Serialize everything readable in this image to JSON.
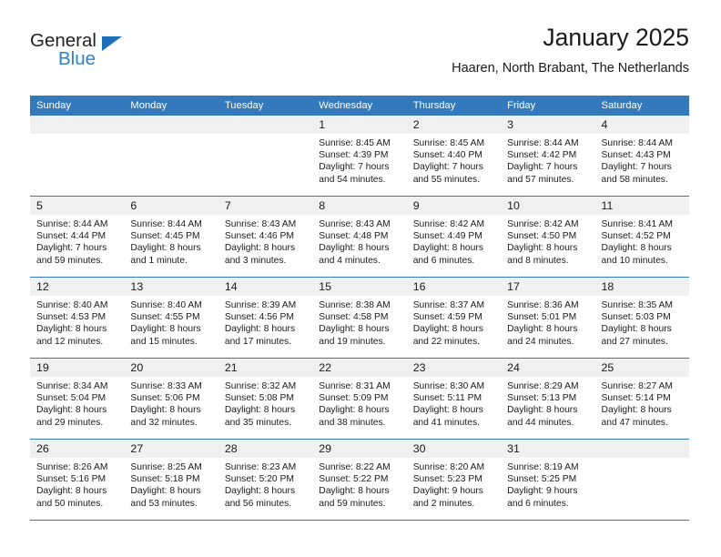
{
  "brand": {
    "name_part1": "General",
    "name_part2": "Blue"
  },
  "header": {
    "title": "January 2025",
    "subtitle": "Haaren, North Brabant, The Netherlands"
  },
  "colors": {
    "header_blue": "#3479bb",
    "logo_blue": "#2d83c8",
    "daynum_band": "#f0f0f0"
  },
  "weekday_headers": [
    "Sunday",
    "Monday",
    "Tuesday",
    "Wednesday",
    "Thursday",
    "Friday",
    "Saturday"
  ],
  "weeks": [
    [
      {
        "day": "",
        "empty": true
      },
      {
        "day": "",
        "empty": true
      },
      {
        "day": "",
        "empty": true
      },
      {
        "day": "1",
        "sunrise": "Sunrise: 8:45 AM",
        "sunset": "Sunset: 4:39 PM",
        "daylight_line1": "Daylight: 7 hours",
        "daylight_line2": "and 54 minutes."
      },
      {
        "day": "2",
        "sunrise": "Sunrise: 8:45 AM",
        "sunset": "Sunset: 4:40 PM",
        "daylight_line1": "Daylight: 7 hours",
        "daylight_line2": "and 55 minutes."
      },
      {
        "day": "3",
        "sunrise": "Sunrise: 8:44 AM",
        "sunset": "Sunset: 4:42 PM",
        "daylight_line1": "Daylight: 7 hours",
        "daylight_line2": "and 57 minutes."
      },
      {
        "day": "4",
        "sunrise": "Sunrise: 8:44 AM",
        "sunset": "Sunset: 4:43 PM",
        "daylight_line1": "Daylight: 7 hours",
        "daylight_line2": "and 58 minutes."
      }
    ],
    [
      {
        "day": "5",
        "sunrise": "Sunrise: 8:44 AM",
        "sunset": "Sunset: 4:44 PM",
        "daylight_line1": "Daylight: 7 hours",
        "daylight_line2": "and 59 minutes."
      },
      {
        "day": "6",
        "sunrise": "Sunrise: 8:44 AM",
        "sunset": "Sunset: 4:45 PM",
        "daylight_line1": "Daylight: 8 hours",
        "daylight_line2": "and 1 minute."
      },
      {
        "day": "7",
        "sunrise": "Sunrise: 8:43 AM",
        "sunset": "Sunset: 4:46 PM",
        "daylight_line1": "Daylight: 8 hours",
        "daylight_line2": "and 3 minutes."
      },
      {
        "day": "8",
        "sunrise": "Sunrise: 8:43 AM",
        "sunset": "Sunset: 4:48 PM",
        "daylight_line1": "Daylight: 8 hours",
        "daylight_line2": "and 4 minutes."
      },
      {
        "day": "9",
        "sunrise": "Sunrise: 8:42 AM",
        "sunset": "Sunset: 4:49 PM",
        "daylight_line1": "Daylight: 8 hours",
        "daylight_line2": "and 6 minutes."
      },
      {
        "day": "10",
        "sunrise": "Sunrise: 8:42 AM",
        "sunset": "Sunset: 4:50 PM",
        "daylight_line1": "Daylight: 8 hours",
        "daylight_line2": "and 8 minutes."
      },
      {
        "day": "11",
        "sunrise": "Sunrise: 8:41 AM",
        "sunset": "Sunset: 4:52 PM",
        "daylight_line1": "Daylight: 8 hours",
        "daylight_line2": "and 10 minutes."
      }
    ],
    [
      {
        "day": "12",
        "sunrise": "Sunrise: 8:40 AM",
        "sunset": "Sunset: 4:53 PM",
        "daylight_line1": "Daylight: 8 hours",
        "daylight_line2": "and 12 minutes."
      },
      {
        "day": "13",
        "sunrise": "Sunrise: 8:40 AM",
        "sunset": "Sunset: 4:55 PM",
        "daylight_line1": "Daylight: 8 hours",
        "daylight_line2": "and 15 minutes."
      },
      {
        "day": "14",
        "sunrise": "Sunrise: 8:39 AM",
        "sunset": "Sunset: 4:56 PM",
        "daylight_line1": "Daylight: 8 hours",
        "daylight_line2": "and 17 minutes."
      },
      {
        "day": "15",
        "sunrise": "Sunrise: 8:38 AM",
        "sunset": "Sunset: 4:58 PM",
        "daylight_line1": "Daylight: 8 hours",
        "daylight_line2": "and 19 minutes."
      },
      {
        "day": "16",
        "sunrise": "Sunrise: 8:37 AM",
        "sunset": "Sunset: 4:59 PM",
        "daylight_line1": "Daylight: 8 hours",
        "daylight_line2": "and 22 minutes."
      },
      {
        "day": "17",
        "sunrise": "Sunrise: 8:36 AM",
        "sunset": "Sunset: 5:01 PM",
        "daylight_line1": "Daylight: 8 hours",
        "daylight_line2": "and 24 minutes."
      },
      {
        "day": "18",
        "sunrise": "Sunrise: 8:35 AM",
        "sunset": "Sunset: 5:03 PM",
        "daylight_line1": "Daylight: 8 hours",
        "daylight_line2": "and 27 minutes."
      }
    ],
    [
      {
        "day": "19",
        "sunrise": "Sunrise: 8:34 AM",
        "sunset": "Sunset: 5:04 PM",
        "daylight_line1": "Daylight: 8 hours",
        "daylight_line2": "and 29 minutes."
      },
      {
        "day": "20",
        "sunrise": "Sunrise: 8:33 AM",
        "sunset": "Sunset: 5:06 PM",
        "daylight_line1": "Daylight: 8 hours",
        "daylight_line2": "and 32 minutes."
      },
      {
        "day": "21",
        "sunrise": "Sunrise: 8:32 AM",
        "sunset": "Sunset: 5:08 PM",
        "daylight_line1": "Daylight: 8 hours",
        "daylight_line2": "and 35 minutes."
      },
      {
        "day": "22",
        "sunrise": "Sunrise: 8:31 AM",
        "sunset": "Sunset: 5:09 PM",
        "daylight_line1": "Daylight: 8 hours",
        "daylight_line2": "and 38 minutes."
      },
      {
        "day": "23",
        "sunrise": "Sunrise: 8:30 AM",
        "sunset": "Sunset: 5:11 PM",
        "daylight_line1": "Daylight: 8 hours",
        "daylight_line2": "and 41 minutes."
      },
      {
        "day": "24",
        "sunrise": "Sunrise: 8:29 AM",
        "sunset": "Sunset: 5:13 PM",
        "daylight_line1": "Daylight: 8 hours",
        "daylight_line2": "and 44 minutes."
      },
      {
        "day": "25",
        "sunrise": "Sunrise: 8:27 AM",
        "sunset": "Sunset: 5:14 PM",
        "daylight_line1": "Daylight: 8 hours",
        "daylight_line2": "and 47 minutes."
      }
    ],
    [
      {
        "day": "26",
        "sunrise": "Sunrise: 8:26 AM",
        "sunset": "Sunset: 5:16 PM",
        "daylight_line1": "Daylight: 8 hours",
        "daylight_line2": "and 50 minutes."
      },
      {
        "day": "27",
        "sunrise": "Sunrise: 8:25 AM",
        "sunset": "Sunset: 5:18 PM",
        "daylight_line1": "Daylight: 8 hours",
        "daylight_line2": "and 53 minutes."
      },
      {
        "day": "28",
        "sunrise": "Sunrise: 8:23 AM",
        "sunset": "Sunset: 5:20 PM",
        "daylight_line1": "Daylight: 8 hours",
        "daylight_line2": "and 56 minutes."
      },
      {
        "day": "29",
        "sunrise": "Sunrise: 8:22 AM",
        "sunset": "Sunset: 5:22 PM",
        "daylight_line1": "Daylight: 8 hours",
        "daylight_line2": "and 59 minutes."
      },
      {
        "day": "30",
        "sunrise": "Sunrise: 8:20 AM",
        "sunset": "Sunset: 5:23 PM",
        "daylight_line1": "Daylight: 9 hours",
        "daylight_line2": "and 2 minutes."
      },
      {
        "day": "31",
        "sunrise": "Sunrise: 8:19 AM",
        "sunset": "Sunset: 5:25 PM",
        "daylight_line1": "Daylight: 9 hours",
        "daylight_line2": "and 6 minutes."
      },
      {
        "day": "",
        "empty": true
      }
    ]
  ]
}
